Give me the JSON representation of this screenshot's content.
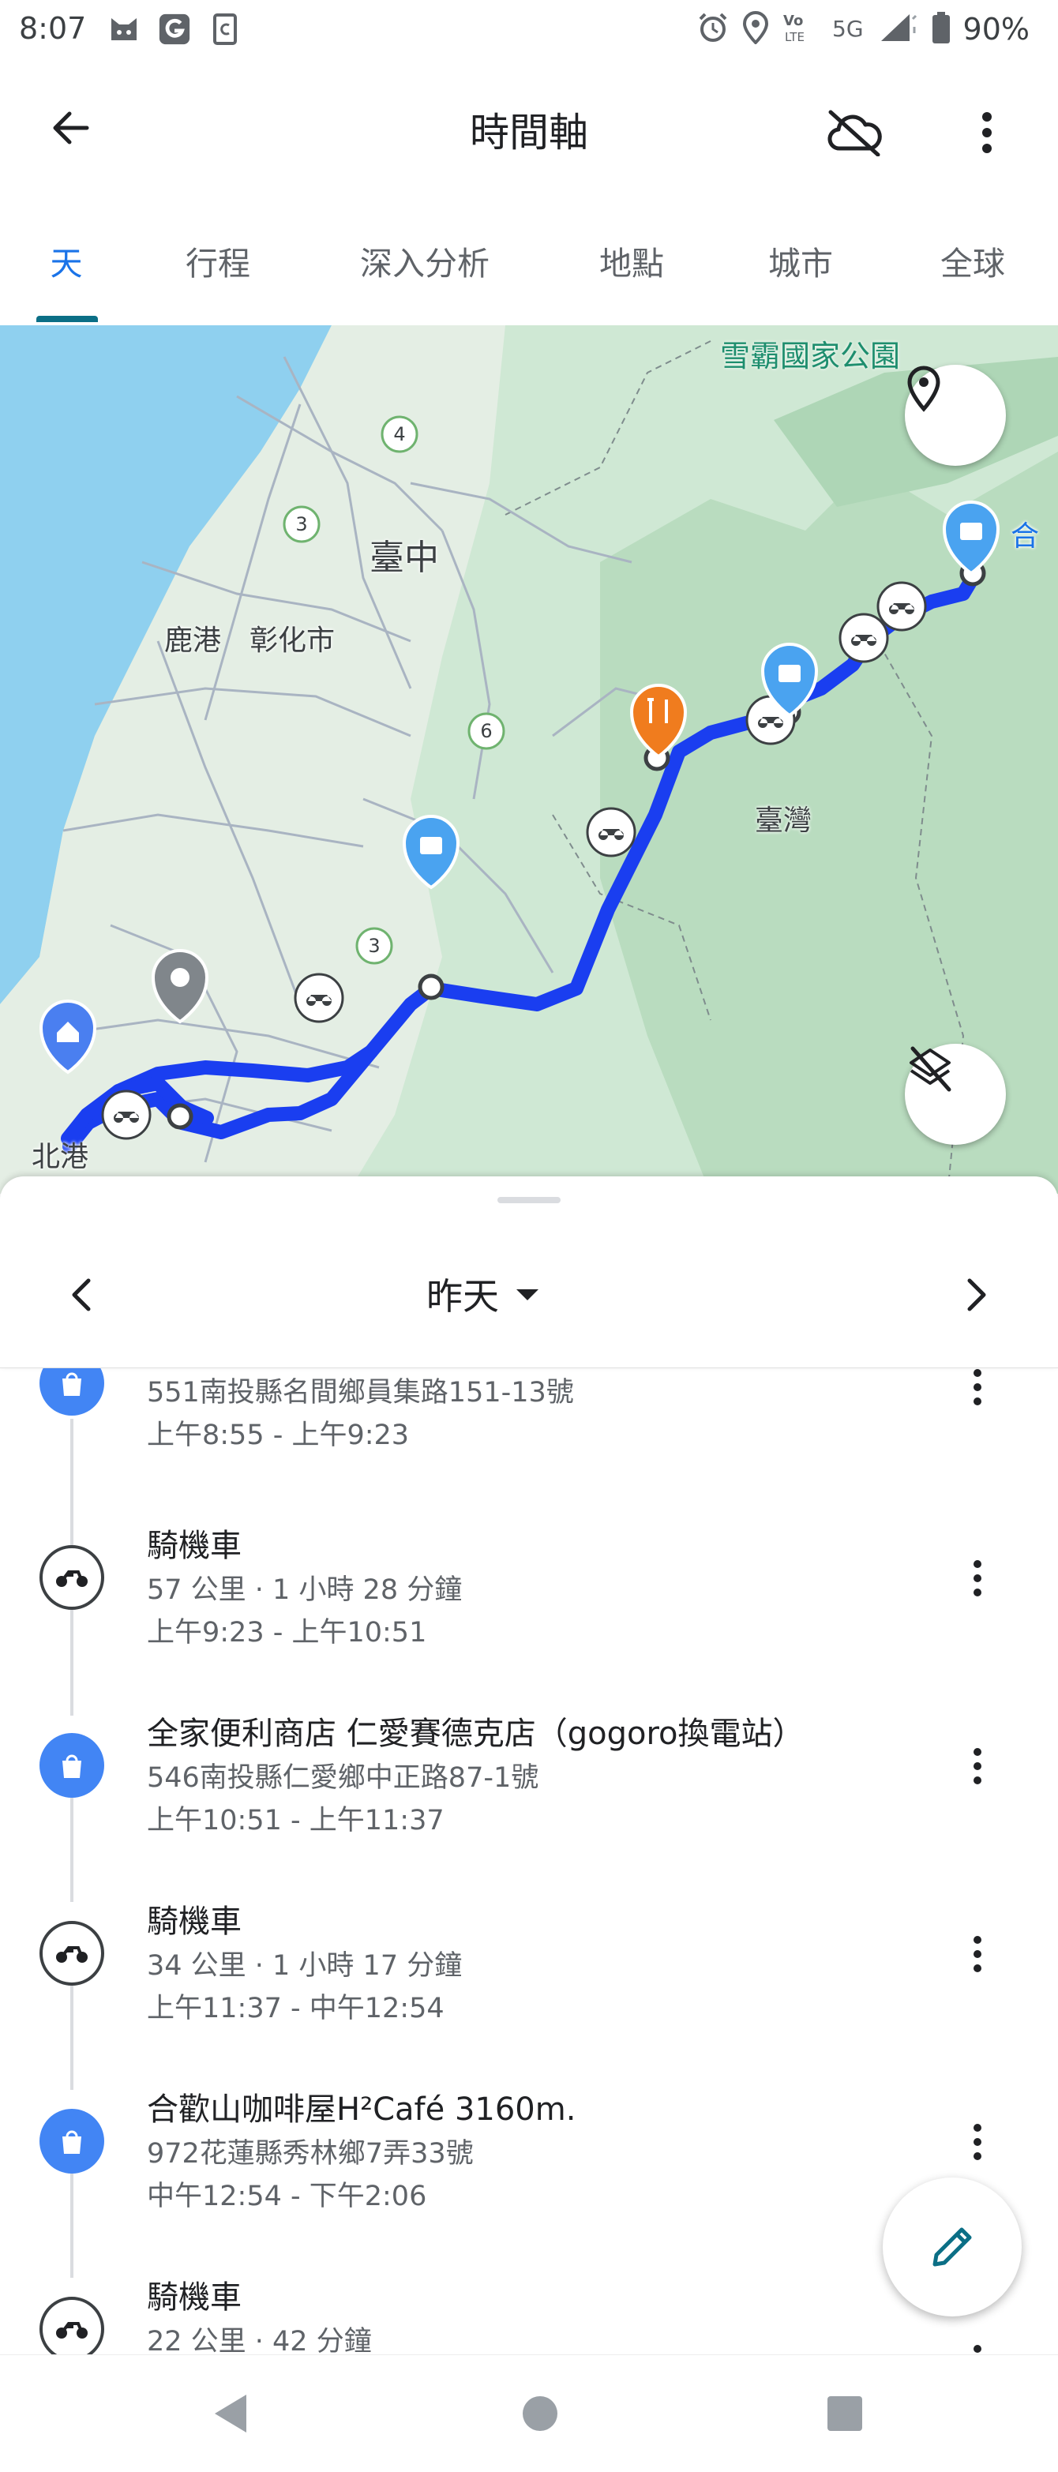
{
  "status_bar": {
    "time": "8:07",
    "battery_text": "90%",
    "left_icons": [
      "cat-face-icon",
      "g-logo-icon",
      "c-badge-icon"
    ],
    "right_icons": [
      "alarm-icon",
      "location-icon",
      "volte-icon",
      "5g-icon",
      "signal-icon",
      "battery-icon"
    ]
  },
  "app_bar": {
    "title": "時間軸"
  },
  "tabs": [
    {
      "label": "天",
      "active": true
    },
    {
      "label": "行程",
      "active": false
    },
    {
      "label": "深入分析",
      "active": false
    },
    {
      "label": "地點",
      "active": false
    },
    {
      "label": "城市",
      "active": false
    },
    {
      "label": "全球",
      "active": false
    }
  ],
  "map": {
    "labels": {
      "park": "雪霸國家公園",
      "taichung": "臺中",
      "lukang": "鹿港",
      "changhua": "彰化市",
      "taiwan": "臺灣",
      "beigang": "北港",
      "hehuan_partial": "合"
    },
    "route_badges": [
      "4",
      "3",
      "6",
      "3"
    ],
    "route_color": "#1a3ef0",
    "place_marker_color": "#4aa3f0",
    "food_marker_color": "#f07c1e"
  },
  "day_nav": {
    "label": "昨天"
  },
  "timeline": [
    {
      "type": "place",
      "title": "",
      "line1": "551南投縣名間鄉員集路151-13號",
      "line2": "上午8:55 - 上午9:23"
    },
    {
      "type": "move",
      "title": "騎機車",
      "line1": "57 公里 · 1 小時 28 分鐘",
      "line2": "上午9:23 - 上午10:51"
    },
    {
      "type": "place",
      "title": "全家便利商店 仁愛賽德克店（gogoro換電站）",
      "line1": "546南投縣仁愛鄉中正路87-1號",
      "line2": "上午10:51 - 上午11:37"
    },
    {
      "type": "move",
      "title": "騎機車",
      "line1": "34 公里 · 1 小時 17 分鐘",
      "line2": "上午11:37 - 中午12:54"
    },
    {
      "type": "place",
      "title": "合歡山咖啡屋H²Café 3160m.",
      "line1": "972花蓮縣秀林鄉7弄33號",
      "line2": "中午12:54 - 下午2:06"
    },
    {
      "type": "move",
      "title": "騎機車",
      "line1": "22 公里 · 42 分鐘",
      "line2": ""
    }
  ],
  "colors": {
    "accent": "#1a73e8",
    "tab_indicator": "#0b6f86",
    "place_icon": "#4285f4"
  }
}
